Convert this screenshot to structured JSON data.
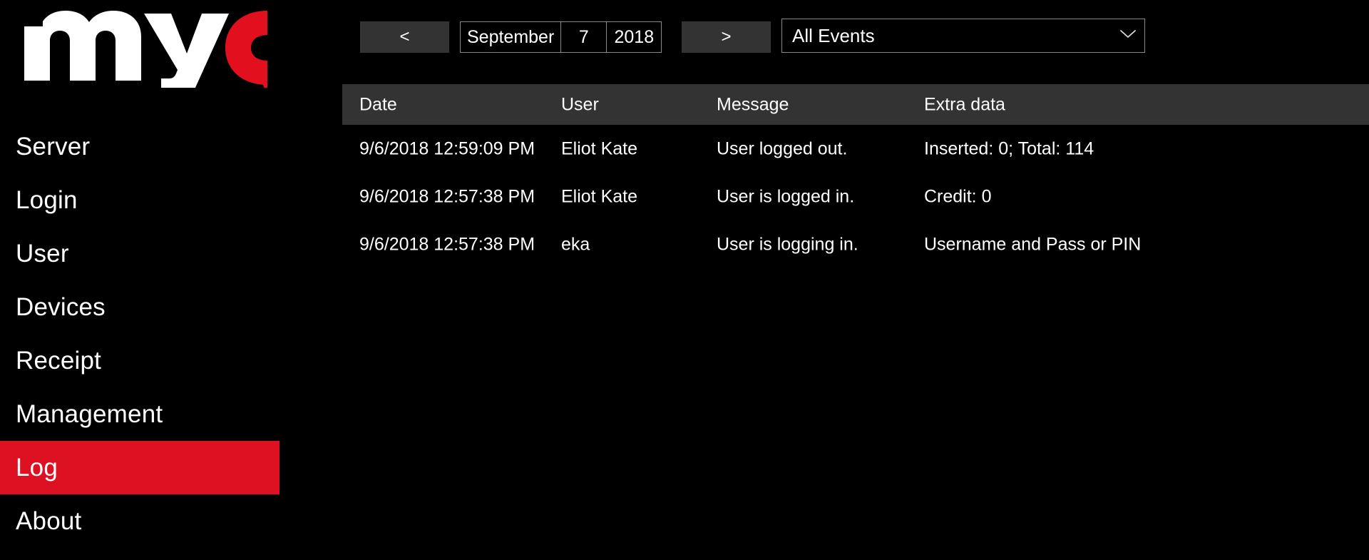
{
  "app": {
    "logo_text": "myQ",
    "logo_white_part": "my",
    "logo_red_part": "Q",
    "brand_red": "#DE1122",
    "background": "#000000",
    "header_background": "#333333"
  },
  "sidebar": {
    "items": [
      {
        "label": "Server",
        "active": false
      },
      {
        "label": "Login",
        "active": false
      },
      {
        "label": "User",
        "active": false
      },
      {
        "label": "Devices",
        "active": false
      },
      {
        "label": "Receipt",
        "active": false
      },
      {
        "label": "Management",
        "active": false
      },
      {
        "label": "Log",
        "active": true
      },
      {
        "label": "About",
        "active": false
      }
    ]
  },
  "toolbar": {
    "prev_label": "<",
    "next_label": ">",
    "date": {
      "month": "September",
      "day": "7",
      "year": "2018"
    },
    "event_filter": {
      "selected": "All Events",
      "chevron": "chevron-down-icon"
    }
  },
  "table": {
    "columns": [
      "Date",
      "User",
      "Message",
      "Extra data"
    ],
    "rows": [
      {
        "date": "9/6/2018 12:59:09 PM",
        "user": "Eliot Kate",
        "message": "User logged out.",
        "extra": "Inserted: 0; Total: 114"
      },
      {
        "date": "9/6/2018 12:57:38 PM",
        "user": "Eliot Kate",
        "message": "User is logged in.",
        "extra": "Credit: 0"
      },
      {
        "date": "9/6/2018 12:57:38 PM",
        "user": "eka",
        "message": "User is logging in.",
        "extra": "Username and Pass or PIN"
      }
    ]
  }
}
